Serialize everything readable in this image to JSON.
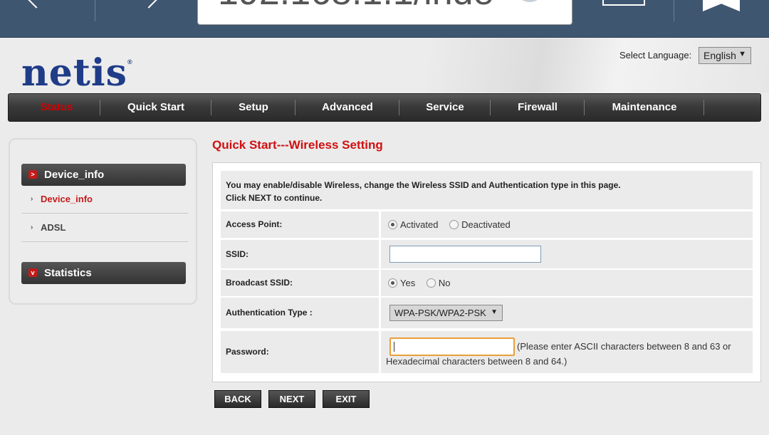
{
  "browser": {
    "url_fragment": "192.168.1.1/inde"
  },
  "header": {
    "logo_text": "netis",
    "logo_mark": "®",
    "language_label": "Select Language:",
    "language_value": "English"
  },
  "nav": {
    "items": [
      "Status",
      "Quick Start",
      "Setup",
      "Advanced",
      "Service",
      "Firewall",
      "Maintenance"
    ],
    "active": "Status"
  },
  "sidebar": {
    "sections": [
      {
        "title": "Device_info",
        "items": [
          "Device_info",
          "ADSL"
        ],
        "active_item": "Device_info"
      },
      {
        "title": "Statistics",
        "items": []
      }
    ]
  },
  "main": {
    "title": "Quick Start---Wireless Setting",
    "intro_line1": "You may enable/disable Wireless, change the Wireless SSID and Authentication type in this page.",
    "intro_line2": "Click NEXT to continue.",
    "access_point": {
      "label": "Access Point:",
      "options": [
        "Activated",
        "Deactivated"
      ],
      "selected": "Activated"
    },
    "ssid": {
      "label": "SSID:",
      "value": ""
    },
    "broadcast": {
      "label": "Broadcast SSID:",
      "options": [
        "Yes",
        "No"
      ],
      "selected": "Yes"
    },
    "auth": {
      "label": "Authentication Type :",
      "value": "WPA-PSK/WPA2-PSK"
    },
    "password": {
      "label": "Password:",
      "value": "",
      "hint_line1": "(Please enter ASCII characters between 8 and 63 or",
      "hint_line2": "Hexadecimal characters between 8 and 64.)"
    }
  },
  "buttons": {
    "back": "BACK",
    "next": "NEXT",
    "exit": "EXIT"
  },
  "colors": {
    "accent_red": "#d01010",
    "logo_blue": "#1f3c88",
    "browser_bar": "#3f5670"
  }
}
